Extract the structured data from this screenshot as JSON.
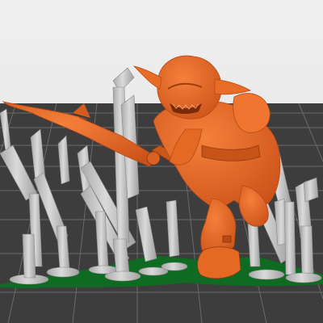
{
  "viewport": {
    "view": "3d-slicer-preview",
    "scene": {
      "background_color": "#eaeaea",
      "bed_color": "#3d3d3d",
      "grid_color": "#6a6a6a",
      "model_color": "#ea6a22",
      "model_shadow_color": "#b9491a",
      "support_color": "#c7c7c7",
      "support_shadow_color": "#9a9a9a",
      "raft_color": "#0f6b22"
    },
    "objects": [
      {
        "name": "goblin-miniature",
        "kind": "model"
      },
      {
        "name": "tree-supports",
        "kind": "supports"
      },
      {
        "name": "print-bed",
        "kind": "bed"
      }
    ]
  }
}
